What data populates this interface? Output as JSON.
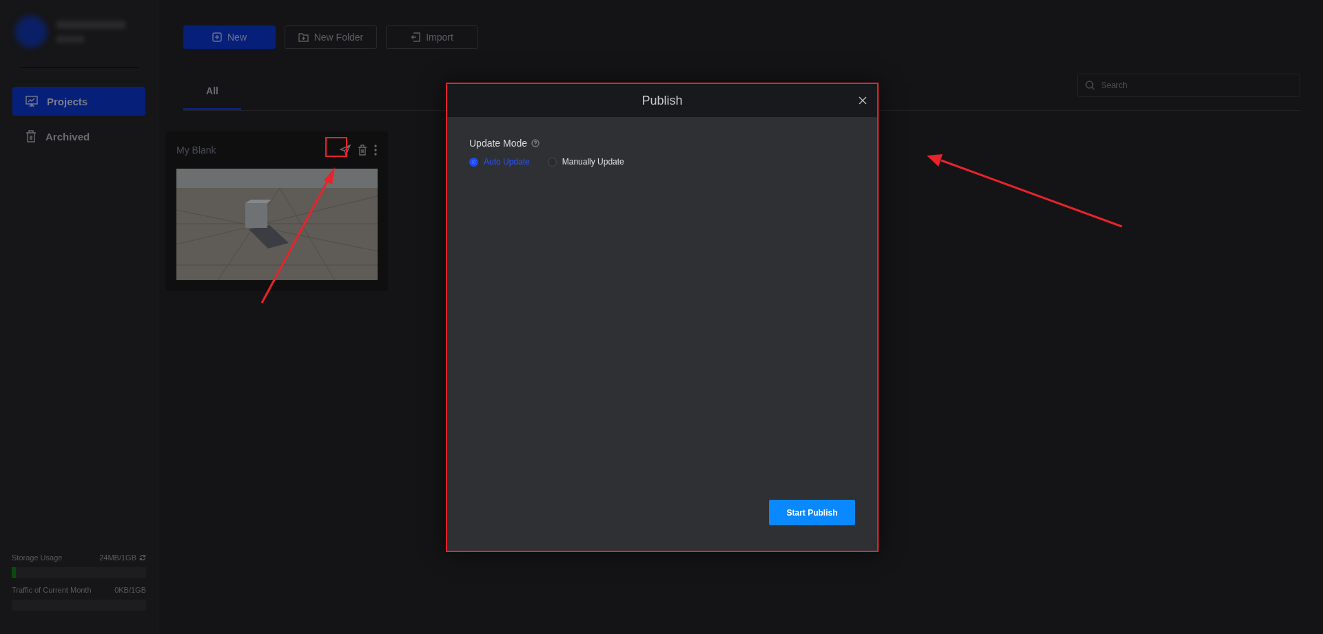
{
  "sidebar": {
    "nav": [
      {
        "label": "Projects",
        "kind": "projects",
        "selected": true
      },
      {
        "label": "Archived",
        "kind": "archived",
        "selected": false
      }
    ],
    "storage": {
      "label": "Storage Usage",
      "reading": "24MB/1GB",
      "level": 0.03
    },
    "traffic": {
      "label": "Traffic of Current Month",
      "reading": "0KB/1GB",
      "level": 0
    }
  },
  "toolbar": {
    "buttons": [
      {
        "label": "New",
        "kind": "primary"
      },
      {
        "label": "New Folder",
        "kind": "folder"
      },
      {
        "label": "Import",
        "kind": "import"
      }
    ]
  },
  "tabs": [
    {
      "label": "All",
      "selected": true
    }
  ],
  "search": {
    "placeholder": "Search"
  },
  "projects": [
    {
      "title": "My Blank"
    }
  ],
  "dialog": {
    "title": "Publish",
    "field_label": "Update Mode",
    "options": [
      {
        "label": "Auto Update",
        "selected": true
      },
      {
        "label": "Manually Update",
        "selected": false
      }
    ],
    "button": "Start Publish"
  }
}
